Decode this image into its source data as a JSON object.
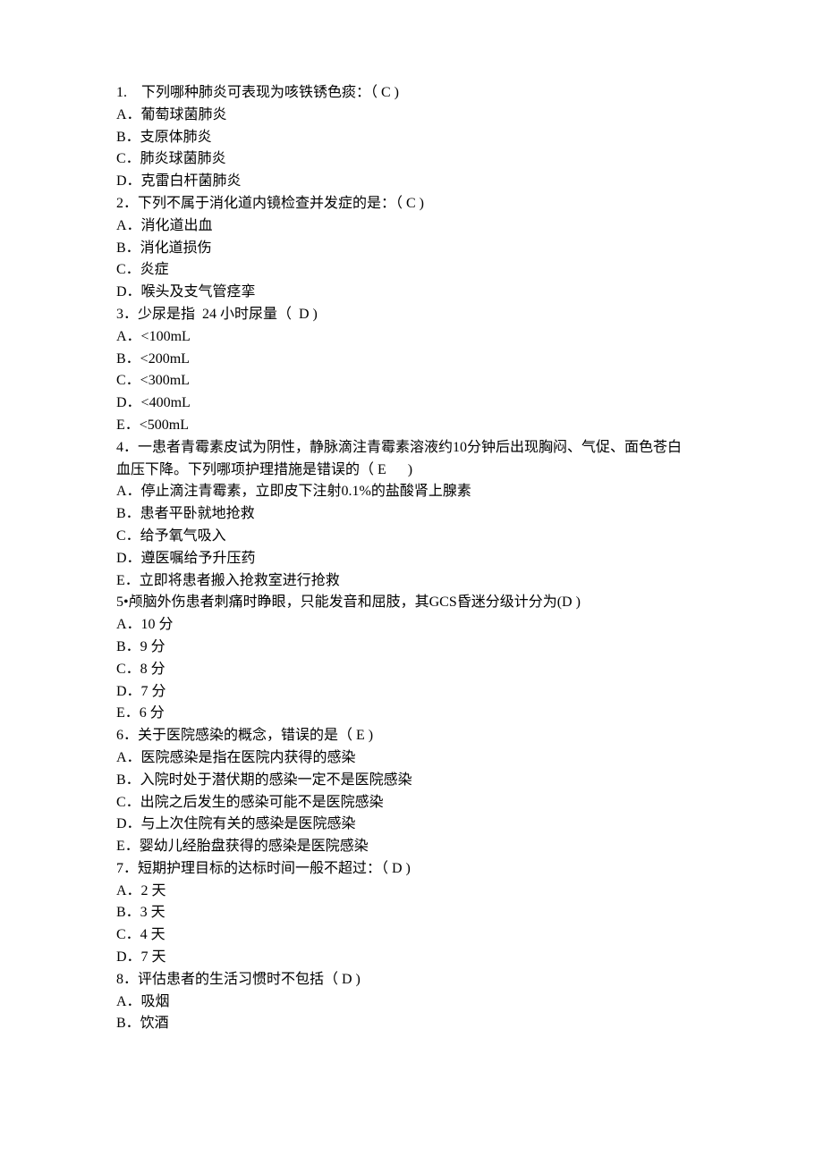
{
  "questions": [
    {
      "stem": [
        "1.    下列哪种肺炎可表现为咳铁锈色痰：（ C )"
      ],
      "options": [
        "A．葡萄球菌肺炎",
        "B．支原体肺炎",
        "C．肺炎球菌肺炎",
        "D．克雷白杆菌肺炎"
      ]
    },
    {
      "stem": [
        "2．下列不属于消化道内镜检查并发症的是：（ C )"
      ],
      "options": [
        "A．消化道出血",
        "B．消化道损伤",
        "C．炎症",
        "D．喉头及支气管痉挛"
      ]
    },
    {
      "stem": [
        "3．少尿是指  24 小时尿量（  D )"
      ],
      "options": [
        "A．<100mL",
        "B．<200mL",
        "C．<300mL",
        "D．<400mL",
        "E．<500mL"
      ]
    },
    {
      "stem": [
        "4．一患者青霉素皮试为阴性，静脉滴注青霉素溶液约10分钟后出现胸闷、气促、面色苍白",
        "血压下降。下列哪项护理措施是错误的（ E      )"
      ],
      "options": [
        "A．停止滴注青霉素，立即皮下注射0.1%的盐酸肾上腺素",
        "B．患者平卧就地抢救",
        "C．给予氧气吸入",
        "D．遵医嘱给予升压药",
        "E．立即将患者搬入抢救室进行抢救"
      ]
    },
    {
      "stem": [
        "5•颅脑外伤患者刺痛时睁眼，只能发音和屈肢，其GCS昏迷分级计分为(D )"
      ],
      "options": [
        "A．10 分",
        "B．9 分",
        "C．8 分",
        "D．7 分",
        "E．6 分"
      ]
    },
    {
      "stem": [
        "6．关于医院感染的概念，错误的是（ E )"
      ],
      "options": [
        "A．医院感染是指在医院内获得的感染",
        "B．入院时处于潜伏期的感染一定不是医院感染",
        "C．出院之后发生的感染可能不是医院感染",
        "D．与上次住院有关的感染是医院感染",
        "E．婴幼儿经胎盘获得的感染是医院感染"
      ]
    },
    {
      "stem": [
        "7．短期护理目标的达标时间一般不超过：（ D )"
      ],
      "options": [
        "A．2 天",
        "B．3 天",
        "C．4 天",
        "D．7 天"
      ]
    },
    {
      "stem": [
        "8．评估患者的生活习惯时不包括（ D )"
      ],
      "options": [
        "A．吸烟",
        "B．饮酒"
      ]
    }
  ]
}
